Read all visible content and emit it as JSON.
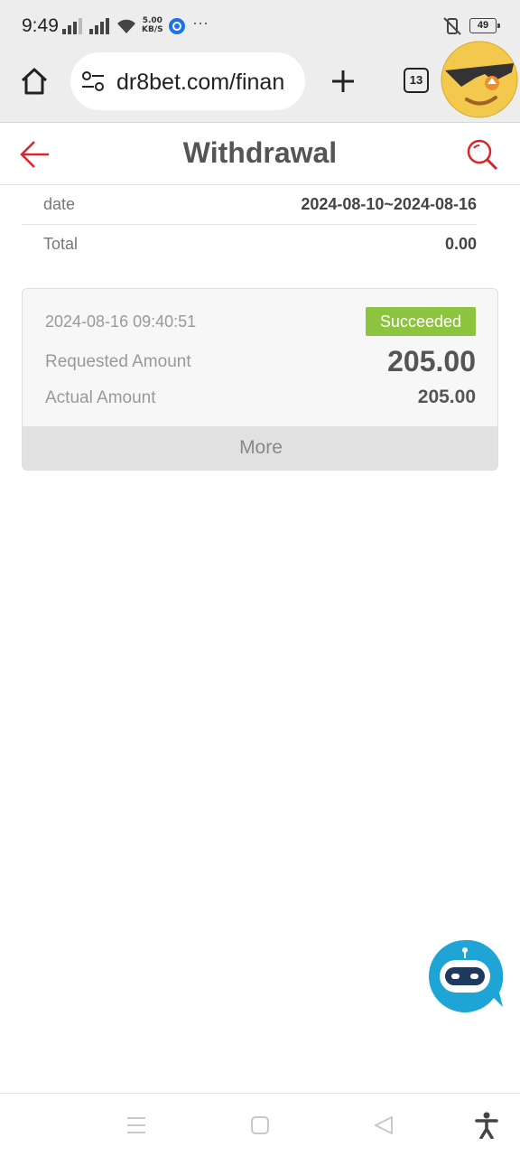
{
  "status_bar": {
    "time": "9:49",
    "net_speed_value": "5.00",
    "net_speed_unit": "KB/S",
    "overflow": "···",
    "battery": "49"
  },
  "browser": {
    "url": "dr8bet.com/finan",
    "tab_count": "13"
  },
  "header": {
    "title": "Withdrawal",
    "accent_color": "#d9252b"
  },
  "summary": {
    "date_label": "date",
    "date_value": "2024-08-10~2024-08-16",
    "total_label": "Total",
    "total_value": "0.00"
  },
  "records": [
    {
      "datetime": "2024-08-16 09:40:51",
      "status": "Succeeded",
      "status_color": "#8dc43f",
      "requested_label": "Requested Amount",
      "requested_value": "205.00",
      "actual_label": "Actual Amount",
      "actual_value": "205.00",
      "more_label": "More"
    }
  ],
  "icons": {
    "home": "home-icon",
    "site_info": "site-settings-icon",
    "new_tab": "plus-icon",
    "avatar": "sunglasses-emoji-icon",
    "back": "back-arrow-icon",
    "search": "search-icon",
    "chatbot": "chatbot-icon",
    "nav_menu": "menu-icon",
    "nav_home": "square-home-icon",
    "nav_back": "triangle-back-icon",
    "accessibility": "accessibility-icon"
  }
}
